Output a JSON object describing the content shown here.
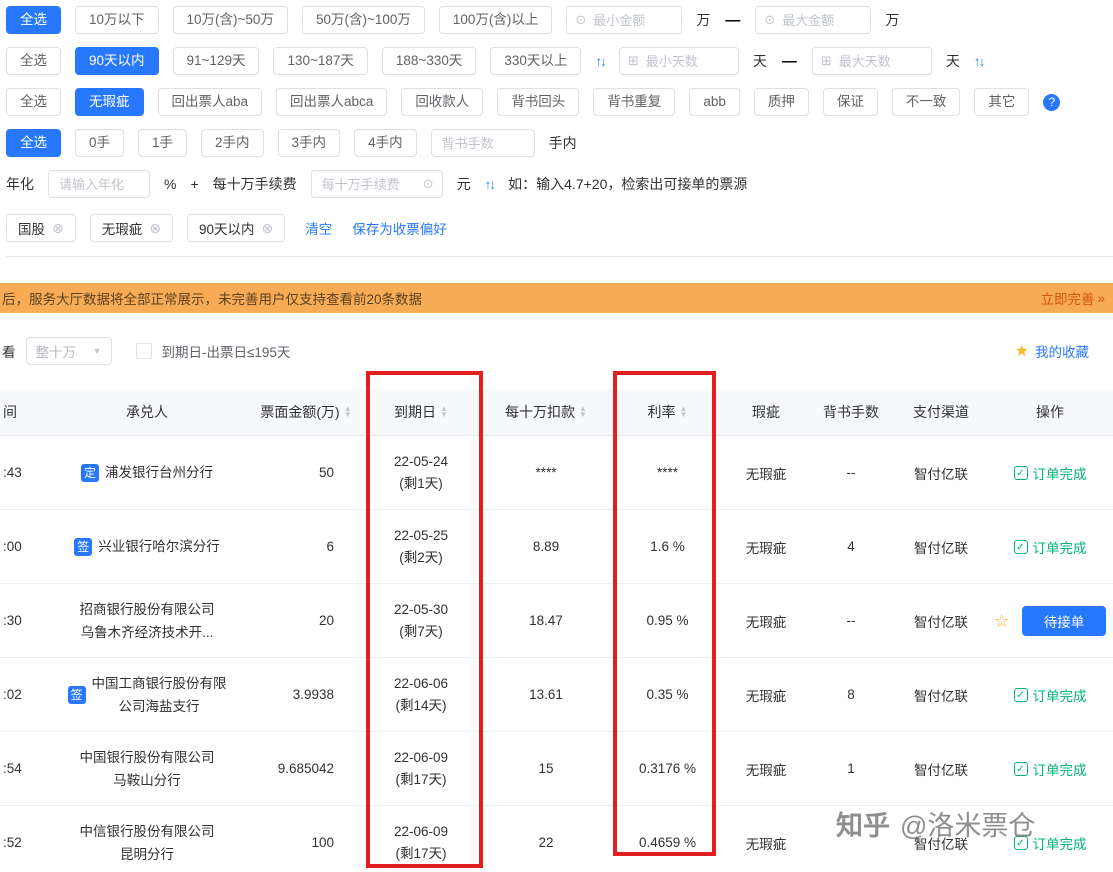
{
  "icons": {
    "money_prefix": "⊙",
    "calendar_prefix": "⊞",
    "sort_up_down": "↑↓",
    "help": "?",
    "close_tag": "⊗",
    "caret_down": "▼",
    "star": "★",
    "star_outline": "☆",
    "check": "✓",
    "double_arrow": "»",
    "sort_asc": "▲",
    "sort_desc": "▼"
  },
  "filters": {
    "amount": {
      "buttons": [
        {
          "label": "全选",
          "selected": true
        },
        {
          "label": "10万以下",
          "selected": false
        },
        {
          "label": "10万(含)~50万",
          "selected": false
        },
        {
          "label": "50万(含)~100万",
          "selected": false
        },
        {
          "label": "100万(含)以上",
          "selected": false
        }
      ],
      "min_placeholder": "最小金额",
      "max_placeholder": "最大金额",
      "unit": "万",
      "dash": "—"
    },
    "days": {
      "buttons": [
        {
          "label": "全选",
          "selected": false
        },
        {
          "label": "90天以内",
          "selected": true
        },
        {
          "label": "91~129天",
          "selected": false
        },
        {
          "label": "130~187天",
          "selected": false
        },
        {
          "label": "188~330天",
          "selected": false
        },
        {
          "label": "330天以上",
          "selected": false
        }
      ],
      "min_placeholder": "最小天数",
      "max_placeholder": "最大天数",
      "unit": "天",
      "dash": "—"
    },
    "flaw": {
      "buttons": [
        {
          "label": "全选",
          "selected": false
        },
        {
          "label": "无瑕疵",
          "selected": true
        },
        {
          "label": "回出票人aba",
          "selected": false
        },
        {
          "label": "回出票人abca",
          "selected": false
        },
        {
          "label": "回收款人",
          "selected": false
        },
        {
          "label": "背书回头",
          "selected": false
        },
        {
          "label": "背书重复",
          "selected": false
        },
        {
          "label": "abb",
          "selected": false
        },
        {
          "label": "质押",
          "selected": false
        },
        {
          "label": "保证",
          "selected": false
        },
        {
          "label": "不一致",
          "selected": false
        },
        {
          "label": "其它",
          "selected": false
        }
      ]
    },
    "endorse": {
      "buttons": [
        {
          "label": "全选",
          "selected": true
        },
        {
          "label": "0手",
          "selected": false
        },
        {
          "label": "1手",
          "selected": false
        },
        {
          "label": "2手内",
          "selected": false
        },
        {
          "label": "3手内",
          "selected": false
        },
        {
          "label": "4手内",
          "selected": false
        }
      ],
      "input_placeholder": "背书手数",
      "suffix": "手内"
    },
    "rate": {
      "label": "年化",
      "input_placeholder": "请输入年化",
      "percent": "%",
      "plus": "+",
      "fee_label": "每十万手续费",
      "fee_placeholder": "每十万手续费",
      "unit": "元",
      "hint": "如：输入4.7+20，检索出可接单的票源"
    },
    "tags": [
      "国股",
      "无瑕疵",
      "90天以内"
    ],
    "clear_label": "清空",
    "save_label": "保存为收票偏好"
  },
  "banner": {
    "text": "后，服务大厅数据将全部正常展示，未完善用户仅支持查看前20条数据",
    "action": "立即完善"
  },
  "toolbar": {
    "left_label": "看",
    "range_option": "整十万",
    "checkbox_label": "到期日-出票日≤195天",
    "favorites_label": "我的收藏"
  },
  "table": {
    "headers": [
      {
        "label": "间",
        "sortable": false
      },
      {
        "label": "承兑人",
        "sortable": false
      },
      {
        "label": "票面金额(万)",
        "sortable": true
      },
      {
        "label": "到期日",
        "sortable": true
      },
      {
        "label": "每十万扣款",
        "sortable": true
      },
      {
        "label": "利率",
        "sortable": true
      },
      {
        "label": "瑕疵",
        "sortable": false
      },
      {
        "label": "背书手数",
        "sortable": false
      },
      {
        "label": "支付渠道",
        "sortable": false
      },
      {
        "label": "操作",
        "sortable": false
      }
    ],
    "rows": [
      {
        "time": ":43",
        "badge": "定",
        "acceptor": [
          "浦发银行台州分行"
        ],
        "amount": "50",
        "due_date": "22-05-24",
        "due_left": "(剩1天)",
        "deduct": "****",
        "rate": "****",
        "flaw": "无瑕疵",
        "endorse": "--",
        "channel": "智付亿联",
        "action": {
          "type": "done",
          "label": "订单完成",
          "starred": false
        }
      },
      {
        "time": ":00",
        "badge": "签",
        "acceptor": [
          "兴业银行哈尔滨分行"
        ],
        "amount": "6",
        "due_date": "22-05-25",
        "due_left": "(剩2天)",
        "deduct": "8.89",
        "rate": "1.6 %",
        "flaw": "无瑕疵",
        "endorse": "4",
        "channel": "智付亿联",
        "action": {
          "type": "done",
          "label": "订单完成",
          "starred": false
        }
      },
      {
        "time": ":30",
        "badge": "",
        "acceptor": [
          "招商银行股份有限公司",
          "乌鲁木齐经济技术开..."
        ],
        "amount": "20",
        "due_date": "22-05-30",
        "due_left": "(剩7天)",
        "deduct": "18.47",
        "rate": "0.95 %",
        "flaw": "无瑕疵",
        "endorse": "--",
        "channel": "智付亿联",
        "action": {
          "type": "pending",
          "label": "待接单",
          "starred": true
        }
      },
      {
        "time": ":02",
        "badge": "签",
        "acceptor": [
          "中国工商银行股份有限",
          "公司海盐支行"
        ],
        "amount": "3.9938",
        "due_date": "22-06-06",
        "due_left": "(剩14天)",
        "deduct": "13.61",
        "rate": "0.35 %",
        "flaw": "无瑕疵",
        "endorse": "8",
        "channel": "智付亿联",
        "action": {
          "type": "done",
          "label": "订单完成",
          "starred": false
        }
      },
      {
        "time": ":54",
        "badge": "",
        "acceptor": [
          "中国银行股份有限公司",
          "马鞍山分行"
        ],
        "amount": "9.685042",
        "due_date": "22-06-09",
        "due_left": "(剩17天)",
        "deduct": "15",
        "rate": "0.3176 %",
        "flaw": "无瑕疵",
        "endorse": "1",
        "channel": "智付亿联",
        "action": {
          "type": "done",
          "label": "订单完成",
          "starred": false
        }
      },
      {
        "time": ":52",
        "badge": "",
        "acceptor": [
          "中信银行股份有限公司",
          "昆明分行"
        ],
        "amount": "100",
        "due_date": "22-06-09",
        "due_left": "(剩17天)",
        "deduct": "22",
        "rate": "0.4659 %",
        "flaw": "无瑕疵",
        "endorse": "",
        "channel": "智付亿联",
        "action": {
          "type": "done",
          "label": "订单完成",
          "starred": false
        }
      }
    ]
  },
  "watermark": {
    "brand": "知乎",
    "handle": "@洛米票仓"
  }
}
